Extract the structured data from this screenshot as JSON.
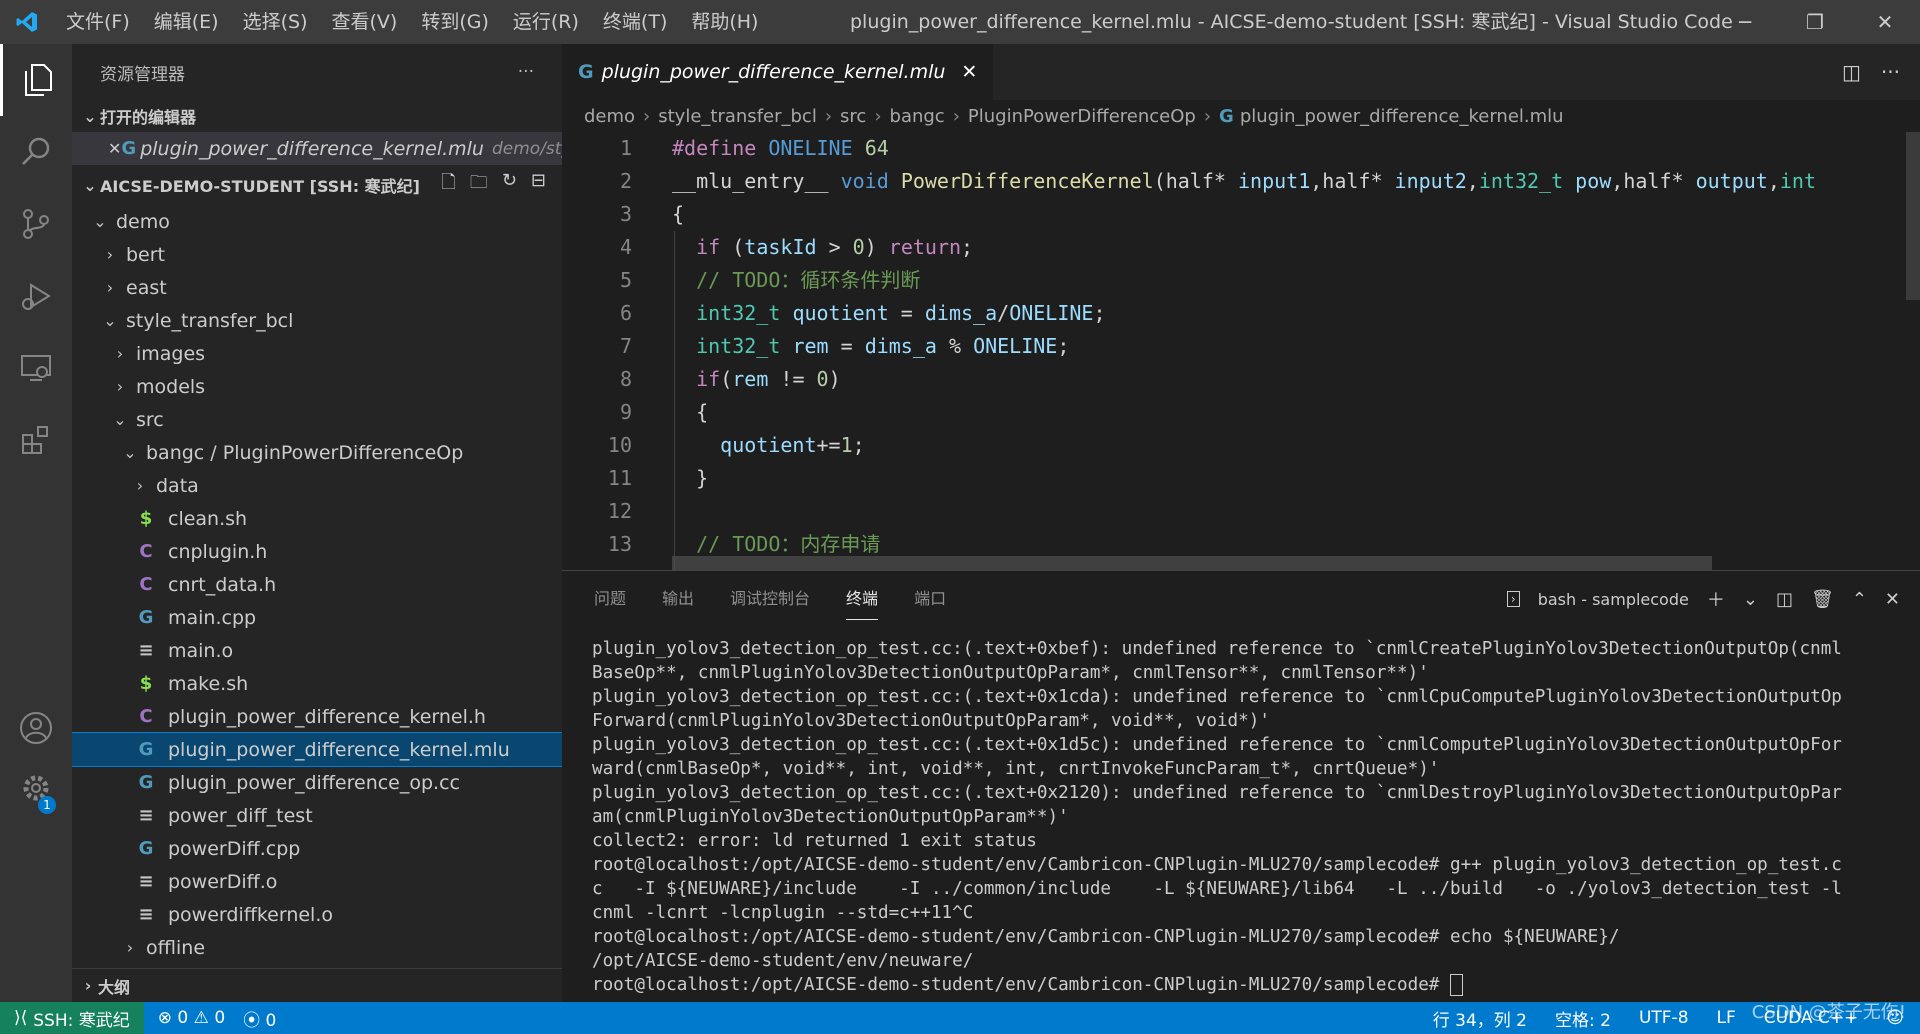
{
  "titlebar": {
    "menus": [
      "文件(F)",
      "编辑(E)",
      "选择(S)",
      "查看(V)",
      "转到(G)",
      "运行(R)",
      "终端(T)",
      "帮助(H)"
    ],
    "title": "plugin_power_difference_kernel.mlu - AICSE-demo-student [SSH: 寒武纪] - Visual Studio Code"
  },
  "sidebar": {
    "title": "资源管理器",
    "open_editors_label": "打开的编辑器",
    "open_file": "plugin_power_difference_kernel.mlu",
    "open_file_path": "demo/sty...",
    "workspace_label": "AICSE-DEMO-STUDENT [SSH: 寒武纪]",
    "tree": [
      {
        "label": "demo",
        "type": "folder-open"
      },
      {
        "label": "bert",
        "type": "folder"
      },
      {
        "label": "east",
        "type": "folder"
      },
      {
        "label": "style_transfer_bcl",
        "type": "folder-open"
      },
      {
        "label": "images",
        "type": "folder"
      },
      {
        "label": "models",
        "type": "folder"
      },
      {
        "label": "src",
        "type": "folder-open"
      },
      {
        "label": "bangc / PluginPowerDifferenceOp",
        "type": "folder-open"
      },
      {
        "label": "data",
        "type": "folder"
      },
      {
        "label": "clean.sh",
        "type": "sh"
      },
      {
        "label": "cnplugin.h",
        "type": "h"
      },
      {
        "label": "cnrt_data.h",
        "type": "h"
      },
      {
        "label": "main.cpp",
        "type": "cpp"
      },
      {
        "label": "main.o",
        "type": "txt"
      },
      {
        "label": "make.sh",
        "type": "sh"
      },
      {
        "label": "plugin_power_difference_kernel.h",
        "type": "h"
      },
      {
        "label": "plugin_power_difference_kernel.mlu",
        "type": "cpp",
        "selected": true
      },
      {
        "label": "plugin_power_difference_op.cc",
        "type": "cpp"
      },
      {
        "label": "power_diff_test",
        "type": "txt"
      },
      {
        "label": "powerDiff.cpp",
        "type": "cpp"
      },
      {
        "label": "powerDiff.o",
        "type": "txt"
      },
      {
        "label": "powerdiffkernel.o",
        "type": "txt"
      },
      {
        "label": "offline",
        "type": "folder"
      }
    ],
    "outline_label": "大纲"
  },
  "editor": {
    "tab": "plugin_power_difference_kernel.mlu",
    "breadcrumb": [
      "demo",
      "style_transfer_bcl",
      "src",
      "bangc",
      "PluginPowerDifferenceOp",
      "plugin_power_difference_kernel.mlu"
    ],
    "line_numbers": [
      "1",
      "2",
      "3",
      "4",
      "5",
      "6",
      "7",
      "8",
      "9",
      "10",
      "11",
      "12",
      "13"
    ]
  },
  "panel": {
    "tabs": [
      "问题",
      "输出",
      "调试控制台",
      "终端",
      "端口"
    ],
    "active_tab": "终端",
    "terminal_name": "bash - samplecode",
    "terminal_lines": [
      "plugin_yolov3_detection_op_test.cc:(.text+0xbef): undefined reference to `cnmlCreatePluginYolov3DetectionOutputOp(cnml",
      "BaseOp**, cnmlPluginYolov3DetectionOutputOpParam*, cnmlTensor**, cnmlTensor**)'",
      "plugin_yolov3_detection_op_test.cc:(.text+0x1cda): undefined reference to `cnmlCpuComputePluginYolov3DetectionOutputOp",
      "Forward(cnmlPluginYolov3DetectionOutputOpParam*, void**, void*)'",
      "plugin_yolov3_detection_op_test.cc:(.text+0x1d5c): undefined reference to `cnmlComputePluginYolov3DetectionOutputOpFor",
      "ward(cnmlBaseOp*, void**, int, void**, int, cnrtInvokeFuncParam_t*, cnrtQueue*)'",
      "plugin_yolov3_detection_op_test.cc:(.text+0x2120): undefined reference to `cnmlDestroyPluginYolov3DetectionOutputOpPar",
      "am(cnmlPluginYolov3DetectionOutputOpParam**)'",
      "collect2: error: ld returned 1 exit status",
      "root@localhost:/opt/AICSE-demo-student/env/Cambricon-CNPlugin-MLU270/samplecode# g++ plugin_yolov3_detection_op_test.c",
      "c   -I ${NEUWARE}/include    -I ../common/include    -L ${NEUWARE}/lib64   -L ../build   -o ./yolov3_detection_test -l",
      "cnml -lcnrt -lcnplugin --std=c++11^C",
      "root@localhost:/opt/AICSE-demo-student/env/Cambricon-CNPlugin-MLU270/samplecode# echo ${NEUWARE}/",
      "/opt/AICSE-demo-student/env/neuware/",
      "root@localhost:/opt/AICSE-demo-student/env/Cambricon-CNPlugin-MLU270/samplecode# "
    ]
  },
  "statusbar": {
    "remote": "SSH: 寒武纪",
    "errors": "0",
    "warnings": "0",
    "ports": "0",
    "position": "行 34，列 2",
    "spaces": "空格: 2",
    "encoding": "UTF-8",
    "eol": "LF",
    "language": "CUDA C++",
    "watermark": "CSDN @茶子无伤!"
  },
  "activity_badge": "1",
  "colors": {
    "accent": "#007acc",
    "remote": "#16825d",
    "selection": "#094771"
  }
}
